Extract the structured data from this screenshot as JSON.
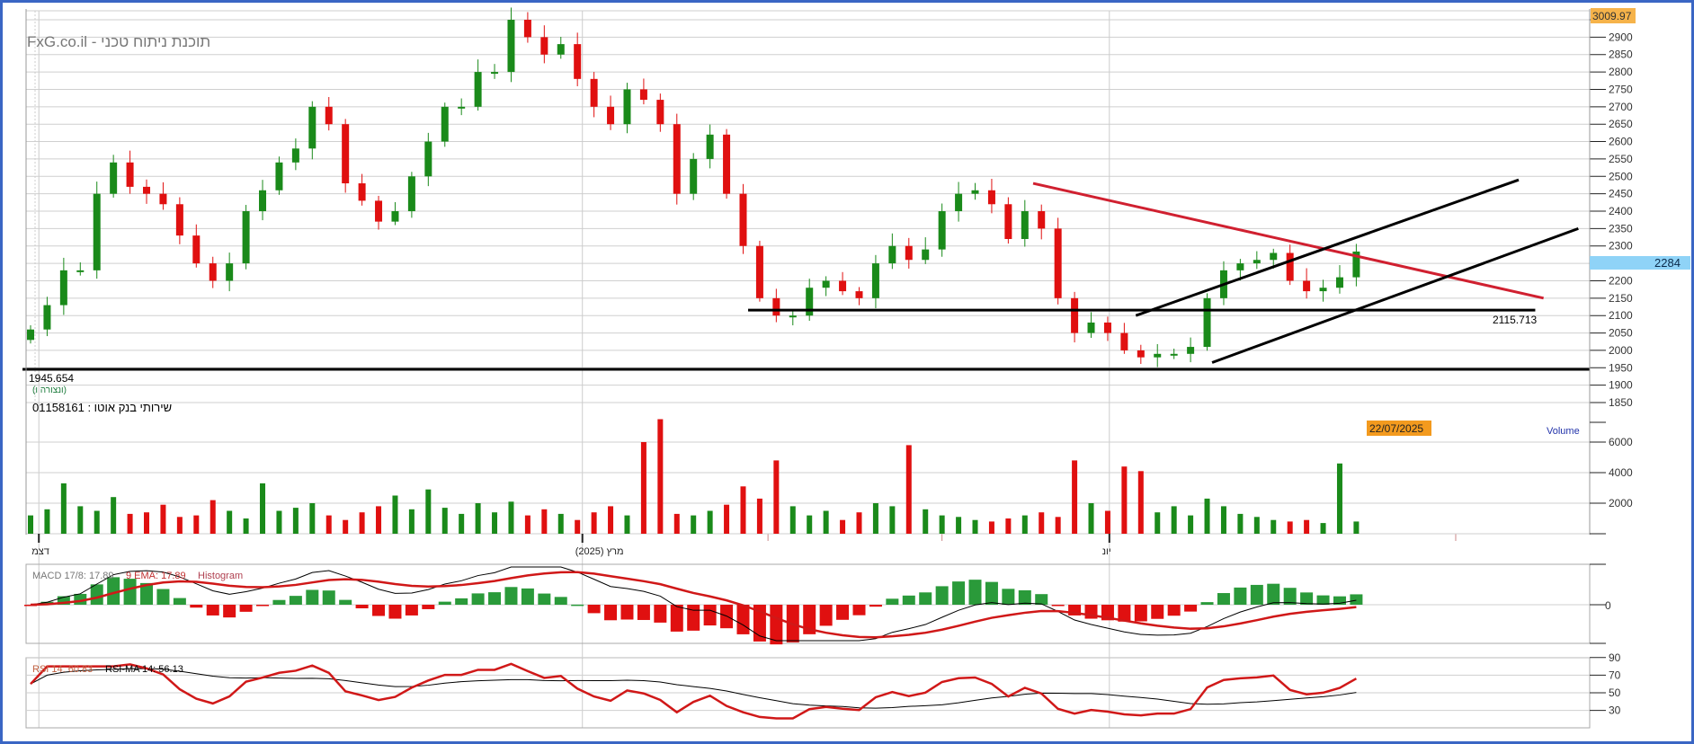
{
  "header": {
    "watermark": "FxG.co.il - תוכנת ניתוח טכני",
    "instrument_name": "שירותי בנק אוטו : 01158161",
    "sub_label": "(ונצורה ו)"
  },
  "colors": {
    "up": "#1a8a1a",
    "down": "#e01010",
    "trend_red": "#d02030",
    "last_price_bg": "#8fd3f7",
    "max_bg": "#f6b34a",
    "date_bg": "#f39a1e",
    "frame": "#3a66c4"
  },
  "chart_data": {
    "type": "candlestick",
    "price_axis": {
      "ylim": [
        1820,
        3010
      ],
      "ticks": [
        1850,
        1900,
        1950,
        2000,
        2050,
        2100,
        2150,
        2200,
        2250,
        2300,
        2350,
        2400,
        2450,
        2500,
        2550,
        2600,
        2650,
        2700,
        2750,
        2800,
        2850,
        2900,
        2950
      ]
    },
    "max_label": "3009.97",
    "last_price": "2284",
    "last_price_value": 2284,
    "closes": [
      2060,
      2130,
      2230,
      2230,
      2450,
      2540,
      2470,
      2450,
      2420,
      2330,
      2250,
      2200,
      2250,
      2400,
      2460,
      2540,
      2580,
      2700,
      2650,
      2480,
      2430,
      2370,
      2400,
      2500,
      2600,
      2700,
      2700,
      2800,
      2800,
      2950,
      2900,
      2850,
      2880,
      2780,
      2700,
      2650,
      2750,
      2720,
      2650,
      2450,
      2550,
      2620,
      2450,
      2300,
      2150,
      2100,
      2100,
      2180,
      2200,
      2170,
      2150,
      2250,
      2300,
      2260,
      2290,
      2400,
      2450,
      2460,
      2420,
      2320,
      2400,
      2350,
      2150,
      2050,
      2080,
      2050,
      2000,
      1980,
      1990,
      1990,
      2010,
      2150,
      2230,
      2250,
      2260,
      2280,
      2200,
      2170,
      2180,
      2210,
      2284
    ],
    "volume": {
      "label": "Volume",
      "ticks": [
        2000,
        4000,
        6000
      ],
      "values": [
        1200,
        1600,
        3300,
        1800,
        1500,
        2400,
        1300,
        1400,
        1900,
        1100,
        1200,
        2200,
        1500,
        1000,
        3300,
        1500,
        1700,
        2000,
        1200,
        900,
        1400,
        1800,
        2500,
        1600,
        2900,
        1700,
        1300,
        2000,
        1400,
        2100,
        1200,
        1600,
        1300,
        900,
        1400,
        1800,
        1200,
        6000,
        7500,
        1300,
        1200,
        1500,
        1900,
        3100,
        2300,
        4800,
        1800,
        1200,
        1500,
        900,
        1400,
        2000,
        1800,
        5800,
        1600,
        1200,
        1100,
        900,
        800,
        1000,
        1200,
        1400,
        1100,
        4800,
        2000,
        1500,
        4400,
        4100,
        1400,
        1800,
        1200,
        2300,
        1800,
        1300,
        1100,
        900,
        800,
        900,
        700,
        4600,
        800
      ]
    },
    "horizontal_lines": [
      {
        "price": 1945.654,
        "label": "1945.654",
        "from": 0,
        "to": 94
      },
      {
        "price": 2115.713,
        "label": "2115.713",
        "from": 43.3,
        "to": 90.8
      }
    ],
    "trendlines": [
      {
        "name": "downtrend",
        "color": "red",
        "x1": 60.5,
        "y1": 2480,
        "x2": 91.3,
        "y2": 2150
      },
      {
        "name": "channel-upper",
        "color": "black",
        "x1": 66.7,
        "y1": 2100,
        "x2": 89.8,
        "y2": 2490
      },
      {
        "name": "channel-lower",
        "color": "black",
        "x1": 71.3,
        "y1": 1965,
        "x2": 93.4,
        "y2": 2350
      }
    ],
    "x_labels": [
      {
        "index": 0.5,
        "label": "דצמ"
      },
      {
        "index": 33.3,
        "label": "מרץ (2025)"
      },
      {
        "index": 65.1,
        "label": "יונ"
      }
    ],
    "x_separators": [
      44.5,
      55,
      86
    ],
    "cursor_date": "22/07/2025",
    "macd": {
      "label": "MACD 17/8: 17.89",
      "ema_label": "9 EMA: 17.89",
      "hist_label": "Histogram",
      "zero_tick": "0"
    },
    "rsi": {
      "label": "RSI 14: 60.83",
      "ma_label": "RSI-MA 14: 56.13",
      "ticks": [
        30,
        50,
        70,
        90
      ]
    }
  }
}
